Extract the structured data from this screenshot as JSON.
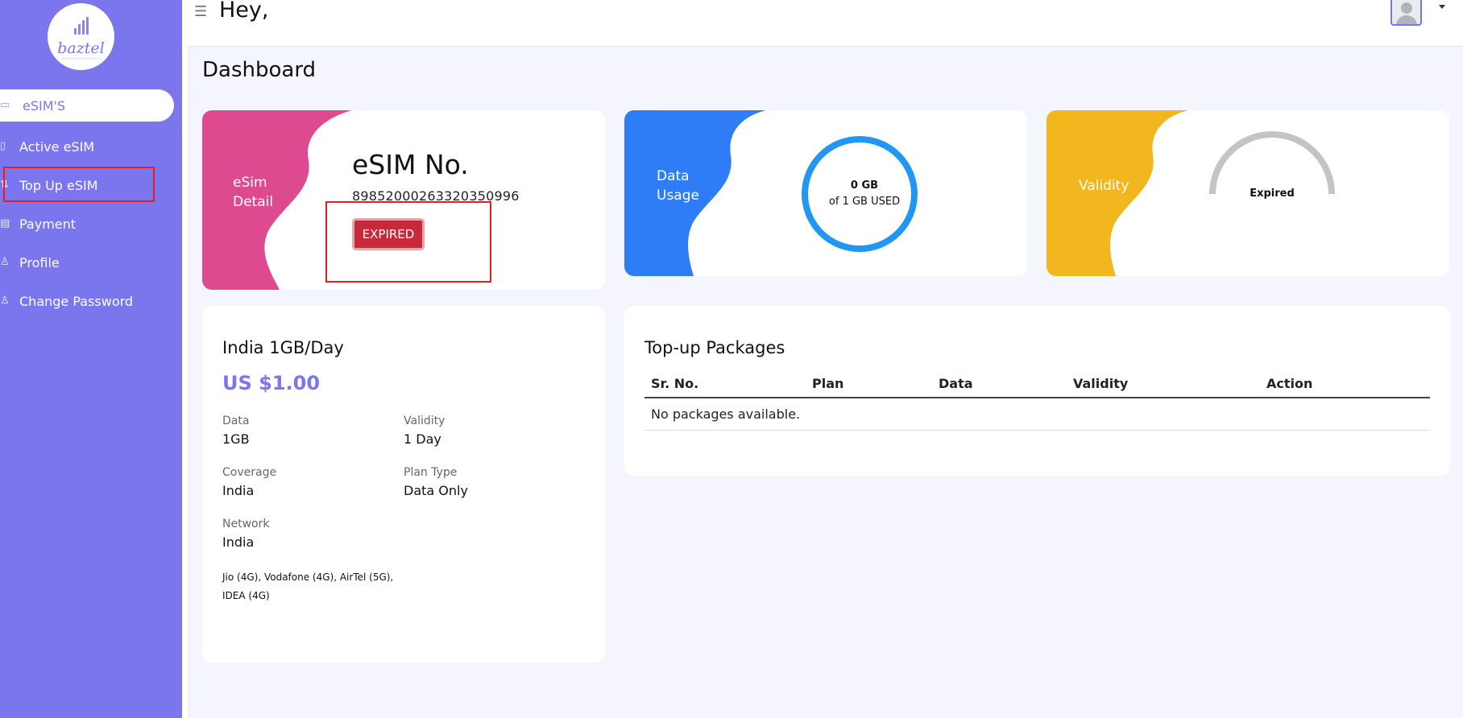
{
  "sidebar": {
    "logo_text": "baztel",
    "items": [
      {
        "label": "eSIM'S",
        "icon": "sim-card-icon"
      },
      {
        "label": "Active eSIM",
        "icon": "signal-icon"
      },
      {
        "label": "Top Up eSIM",
        "icon": "topup-icon"
      },
      {
        "label": "Payment",
        "icon": "credit-card-icon"
      },
      {
        "label": "Profile",
        "icon": "user-icon"
      },
      {
        "label": "Change Password",
        "icon": "lock-icon"
      }
    ]
  },
  "header": {
    "greeting": "Hey,"
  },
  "main": {
    "title": "Dashboard",
    "esim_card": {
      "tag": "eSim Detail",
      "title": "eSIM No.",
      "number": "89852000263320350996",
      "status": "EXPIRED"
    },
    "usage_card": {
      "tag": "Data Usage",
      "used": "0 GB",
      "of_total": "of 1 GB USED",
      "used_fraction": 0
    },
    "validity_card": {
      "tag": "Validity",
      "status": "Expired"
    },
    "plan": {
      "name": "India 1GB/Day",
      "price": "US $1.00",
      "data_label": "Data",
      "data_value": "1GB",
      "validity_label": "Validity",
      "validity_value": "1 Day",
      "coverage_label": "Coverage",
      "coverage_value": "India",
      "plan_type_label": "Plan Type",
      "plan_type_value": "Data Only",
      "network_label": "Network",
      "network_value": "India",
      "networks": "Jio (4G), Vodafone (4G), AirTel (5G), IDEA (4G)"
    },
    "packages": {
      "title": "Top-up Packages",
      "columns": [
        "Sr. No.",
        "Plan",
        "Data",
        "Validity",
        "Action"
      ],
      "empty_message": "No packages available."
    }
  },
  "colors": {
    "sidebar": "#7b75ee",
    "pink": "#dd4a8f",
    "blue": "#2f7df6",
    "yellow": "#f2b71f",
    "donut": "#2196f3",
    "gauge": "#c4c4c4",
    "expired_button": "#c62a3a",
    "highlight": "#e0201f"
  }
}
